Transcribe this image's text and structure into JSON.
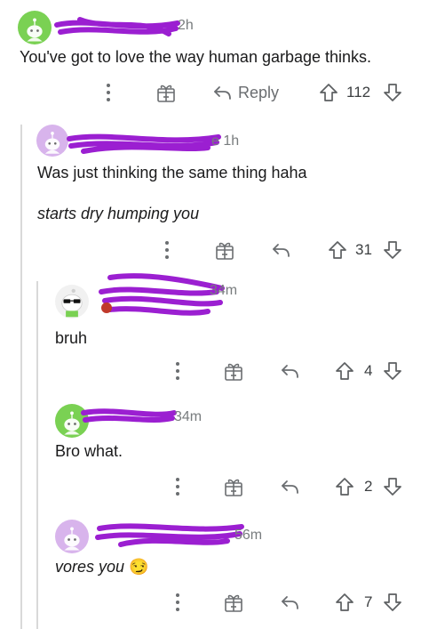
{
  "colors": {
    "redaction": "#9b1fd1",
    "avatar_green": "#7ad153",
    "avatar_lilac": "#d8b4ec",
    "meta_gray": "#787c7e",
    "icon_gray": "#6a6d70"
  },
  "comments": [
    {
      "time": "2h",
      "body": "You've got to love the way human garbage thinks.",
      "reply_label": "Reply",
      "score": "112"
    },
    {
      "time": "e 1h",
      "body": "Was just thinking the same thing haha",
      "body2": "starts dry humping you",
      "score": "31"
    },
    {
      "time": "34m",
      "body": "bruh",
      "score": "4"
    },
    {
      "time": "34m",
      "body": "Bro what.",
      "score": "2"
    },
    {
      "time": "56m",
      "body": "vores you",
      "emoji": "😏",
      "score": "7"
    }
  ],
  "icons": {
    "more": "more-vertical-icon",
    "award": "gift-award-icon",
    "reply": "reply-arrow-icon",
    "upvote": "upvote-arrow-icon",
    "downvote": "downvote-arrow-icon"
  }
}
